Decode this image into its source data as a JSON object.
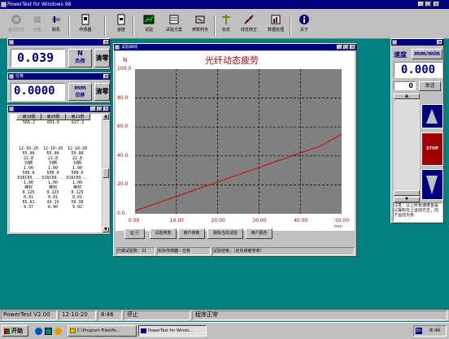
{
  "app": {
    "title": "PowerTest for Windows 98"
  },
  "toolbar": {
    "items": [
      "运行方式",
      "分机",
      "联机",
      "传感器",
      "速度",
      "试验",
      "试验方案",
      "参数判专",
      "标定",
      "线性修正",
      "数据处理",
      "关于"
    ]
  },
  "load_panel": {
    "value": "0.039",
    "unit": "N",
    "unit_label": "负荷",
    "clear": "清零"
  },
  "disp_panel": {
    "title": "位移",
    "value": "0.0000",
    "unit": "mm",
    "unit_label": "位移",
    "clear": "清零"
  },
  "table_panel": {
    "headers": [
      "第19根",
      "第20根",
      "第21根"
    ],
    "top_row": [
      "566.2",
      "601.6",
      "627.3"
    ],
    "rows": [
      [
        "12-10-20",
        "12-10-20",
        "12-10-20"
      ],
      [
        "55.90",
        "55.90",
        "55.90"
      ],
      [
        "22.8",
        "22.8",
        "22.8"
      ],
      [
        "刘婀",
        "刘婀",
        "刘婀"
      ],
      [
        "1.00",
        "1.00",
        "1.00"
      ],
      [
        "500.0",
        "500.0",
        "500.0"
      ],
      [
        "D16C09...",
        "D16C09...",
        "D16C09..."
      ],
      [
        "1.00",
        "1.00",
        "1.00"
      ],
      [
        "棒材",
        "棒材",
        "棒材"
      ],
      [
        "0.125",
        "0.125",
        "0.125"
      ],
      [
        "0.01",
        "0.01",
        "0.01"
      ],
      [
        "55.61",
        "43.19",
        "56.38"
      ],
      [
        "9.37",
        "6.90",
        "9.92"
      ]
    ]
  },
  "curve_window": {
    "title": "试验曲线",
    "buttons": [
      "运 行",
      "试验参数",
      "用户参数",
      "旋除当前试验",
      "用户报告"
    ],
    "status": [
      "已做试验数：21",
      "实际传感器：位移",
      "试验结束，（定负荷疲劳率）"
    ]
  },
  "chart_data": {
    "type": "line",
    "title": "光纤动态疲劳",
    "ylabel": "N",
    "xlabel": "mm",
    "ylim": [
      0,
      100
    ],
    "xlim": [
      0,
      50
    ],
    "yticks": [
      "100.0",
      "80.0",
      "60.0",
      "40.0",
      "20.0",
      "0.0"
    ],
    "xticks": [
      "0.00",
      "10.00",
      "20.00",
      "30.00",
      "40.00",
      "50.00"
    ],
    "grid": true,
    "series": [
      {
        "x": [
          0,
          5,
          10,
          15,
          20,
          25,
          30,
          35,
          40,
          45,
          50
        ],
        "y": [
          2,
          7,
          12,
          17,
          22,
          27,
          32,
          37,
          42,
          47,
          55
        ]
      }
    ],
    "colors": {
      "line": "#d00000",
      "plot_bg": "#808080",
      "grid": "#000000"
    }
  },
  "speed_panel": {
    "title": "速度",
    "unit": "mm/min",
    "value": "0.000",
    "input": "0",
    "send": "发送",
    "stop": "STOP",
    "note": "注意：以上所有速度皆是以摆标在上运动方正，向下运动为负"
  },
  "statusbar": {
    "app": "PowerTest V2.00",
    "date": "12-10-20",
    "time": "8:46",
    "state": "停止",
    "message": "程序正常"
  },
  "taskbar": {
    "start": "开始",
    "tasks": [
      "C:\\Program Files\\Po...",
      "PowerTest for Windo..."
    ],
    "clock": "8:46"
  }
}
